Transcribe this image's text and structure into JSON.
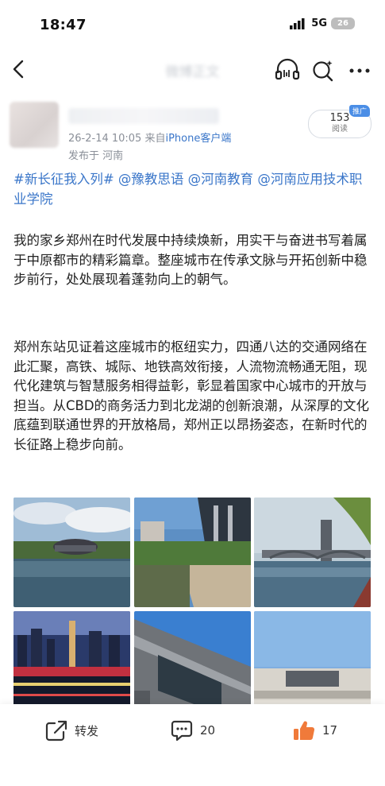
{
  "status_bar": {
    "time": "18:47",
    "network": "5G",
    "battery": "26"
  },
  "nav": {
    "title": "微博正文",
    "icons": [
      "back-arrow-icon",
      "listen-icon",
      "ai-search-icon",
      "more-icon"
    ]
  },
  "author": {
    "meta": "26-2-14 10:05  来自",
    "client": "iPhone客户端",
    "location": "发布于 河南",
    "read_count": "153",
    "read_label": "阅读",
    "promo_badge": "推广"
  },
  "post": {
    "tags": [
      {
        "text": "#新长征我入列# "
      },
      {
        "text": "@豫教思语 "
      },
      {
        "text": "@河南教育 "
      },
      {
        "text": "@河南应用技术职业学院"
      }
    ],
    "paragraph1": "我的家乡郑州在时代发展中持续焕新，用实干与奋进书写着属于中原都市的精彩篇章。整座城市在传承文脉与开拓创新中稳步前行，处处展现着蓬勃向上的朝气。",
    "paragraph2": "郑州东站见证着这座城市的枢纽实力，四通八达的交通网络在此汇聚，高铁、城际、地铁高效衔接，人流物流畅通无阻，现代化建筑与智慧服务相得益彰，彰显着国家中心城市的开放与担当。从CBD的商务活力到北龙湖的创新浪潮，从深厚的文化底蕴到联通世界的开放格局，郑州正以昂扬姿态，在新时代的长征路上稳步向前。"
  },
  "actions": {
    "repost_label": "转发",
    "comment_count": "20",
    "like_count": "17"
  },
  "colors": {
    "link": "#3a76c9",
    "like": "#f07a3a",
    "badge": "#4b8ee6"
  }
}
